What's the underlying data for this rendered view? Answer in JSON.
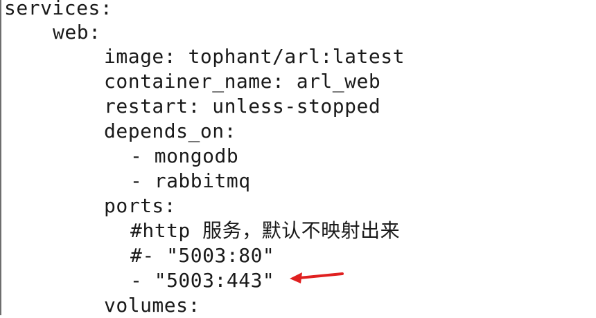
{
  "editor": {
    "lines": [
      "services:",
      "web:",
      "image: tophant/arl:latest",
      "container_name: arl_web",
      "restart: unless-stopped",
      "depends_on:",
      "- mongodb",
      "- rabbitmq",
      "ports:",
      "#http 服务，默认不映射出来",
      "#- \"5003:80\"",
      "- \"5003:443\"",
      "volumes:"
    ]
  },
  "annotation": {
    "arrow_color": "#e02020",
    "arrow_icon": "red-arrow-icon"
  }
}
